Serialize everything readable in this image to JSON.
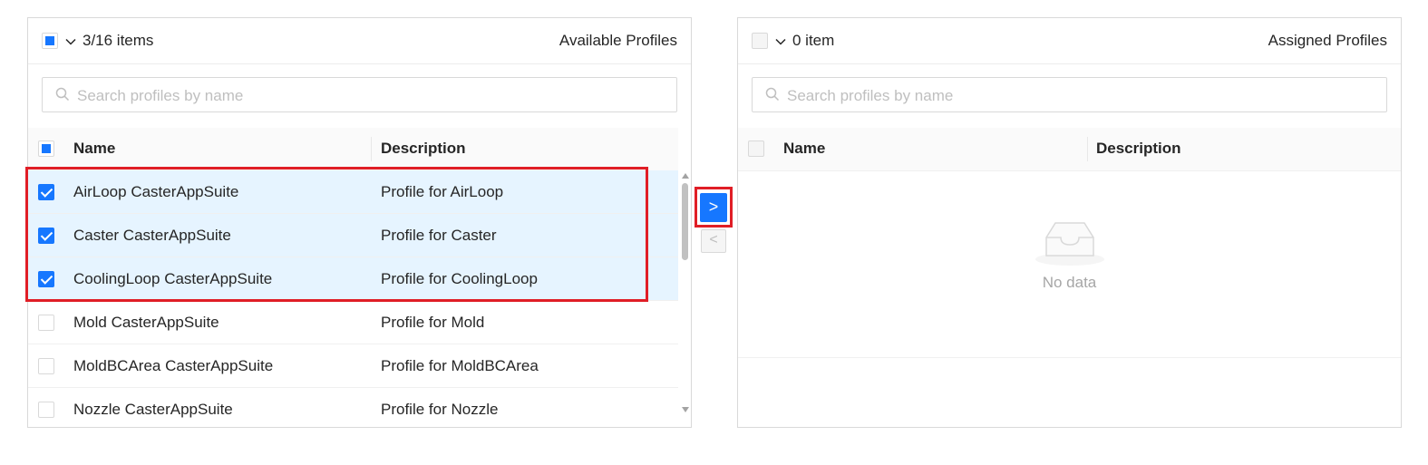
{
  "left_panel": {
    "count": "3/16 items",
    "title": "Available Profiles",
    "search_placeholder": "Search profiles by name",
    "col_name": "Name",
    "col_desc": "Description",
    "rows": [
      {
        "name": "AirLoop CasterAppSuite",
        "desc": "Profile for AirLoop",
        "checked": true
      },
      {
        "name": "Caster CasterAppSuite",
        "desc": "Profile for Caster",
        "checked": true
      },
      {
        "name": "CoolingLoop CasterAppSuite",
        "desc": "Profile for CoolingLoop",
        "checked": true
      },
      {
        "name": "Mold CasterAppSuite",
        "desc": "Profile for Mold",
        "checked": false
      },
      {
        "name": "MoldBCArea CasterAppSuite",
        "desc": "Profile for MoldBCArea",
        "checked": false
      },
      {
        "name": "Nozzle CasterAppSuite",
        "desc": "Profile for Nozzle",
        "checked": false
      }
    ]
  },
  "operations": {
    "move_right": ">",
    "move_left": "<"
  },
  "right_panel": {
    "count": "0 item",
    "title": "Assigned Profiles",
    "search_placeholder": "Search profiles by name",
    "col_name": "Name",
    "col_desc": "Description",
    "empty_text": "No data"
  },
  "colors": {
    "primary": "#1677ff",
    "selected_row": "#e6f4ff",
    "annotation": "#e01e26"
  }
}
